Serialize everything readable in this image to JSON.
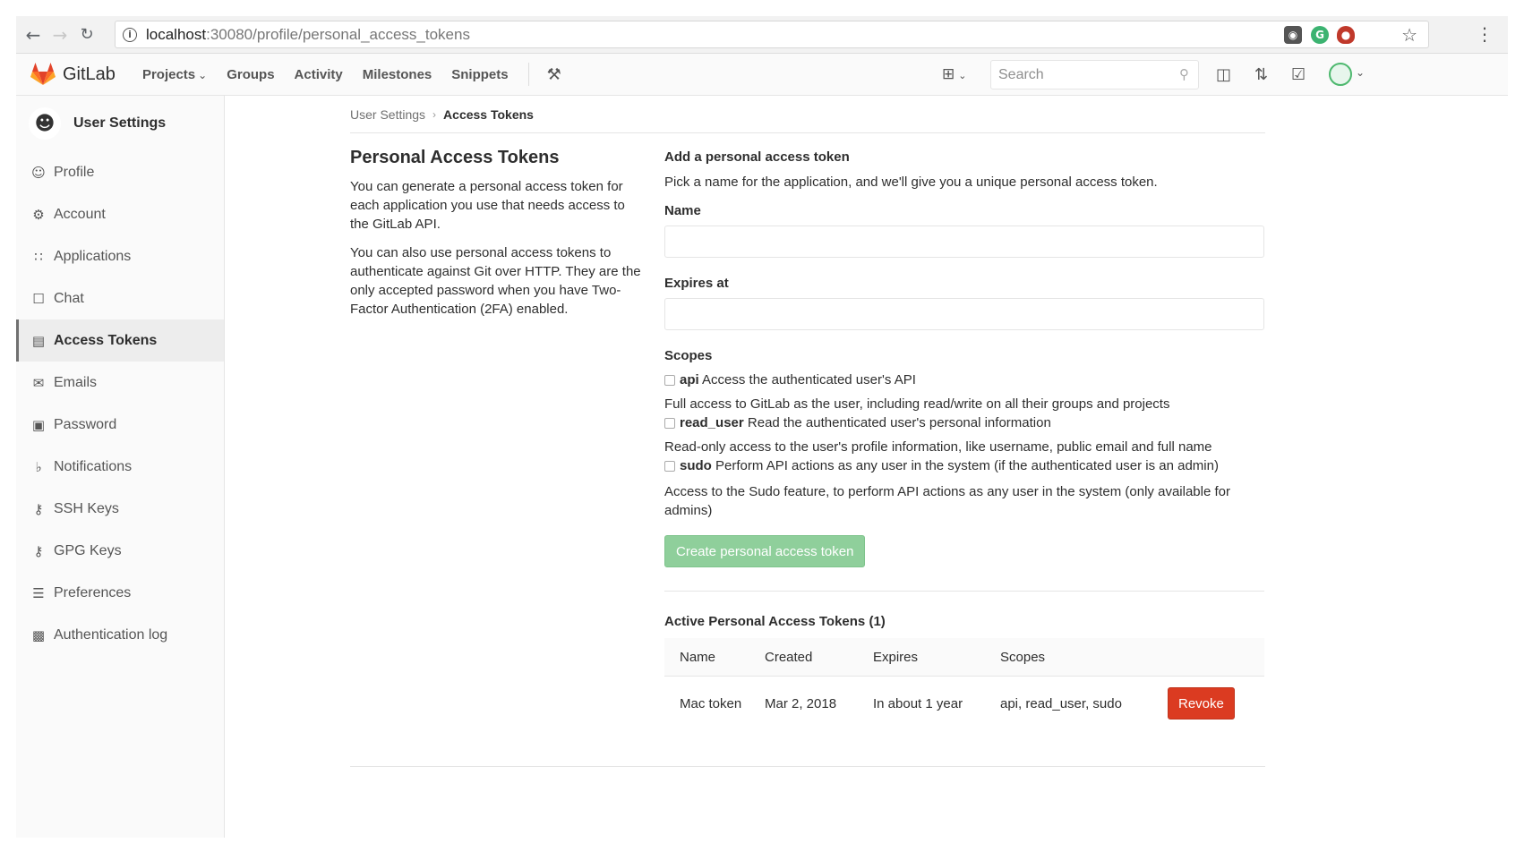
{
  "browser": {
    "url_host": "localhost",
    "url_path": ":30080/profile/personal_access_tokens"
  },
  "header": {
    "brand": "GitLab",
    "nav": [
      "Projects",
      "Groups",
      "Activity",
      "Milestones",
      "Snippets"
    ],
    "search_placeholder": "Search"
  },
  "sidebar": {
    "title": "User Settings",
    "items": [
      {
        "label": "Profile",
        "icon": "profile-icon"
      },
      {
        "label": "Account",
        "icon": "account-icon"
      },
      {
        "label": "Applications",
        "icon": "applications-icon"
      },
      {
        "label": "Chat",
        "icon": "chat-icon"
      },
      {
        "label": "Access Tokens",
        "icon": "token-icon",
        "active": true
      },
      {
        "label": "Emails",
        "icon": "email-icon"
      },
      {
        "label": "Password",
        "icon": "lock-icon"
      },
      {
        "label": "Notifications",
        "icon": "bell-icon"
      },
      {
        "label": "SSH Keys",
        "icon": "key-icon"
      },
      {
        "label": "GPG Keys",
        "icon": "key-icon"
      },
      {
        "label": "Preferences",
        "icon": "sliders-icon"
      },
      {
        "label": "Authentication log",
        "icon": "log-icon"
      }
    ]
  },
  "breadcrumb": {
    "parent": "User Settings",
    "current": "Access Tokens"
  },
  "intro": {
    "title": "Personal Access Tokens",
    "p1": "You can generate a personal access token for each application you use that needs access to the GitLab API.",
    "p2": "You can also use personal access tokens to authenticate against Git over HTTP. They are the only accepted password when you have Two-Factor Authentication (2FA) enabled."
  },
  "form": {
    "heading": "Add a personal access token",
    "description": "Pick a name for the application, and we'll give you a unique personal access token.",
    "name_label": "Name",
    "expires_label": "Expires at",
    "scopes_label": "Scopes",
    "scopes": [
      {
        "key": "api",
        "summary": "Access the authenticated user's API",
        "detail": "Full access to GitLab as the user, including read/write on all their groups and projects"
      },
      {
        "key": "read_user",
        "summary": "Read the authenticated user's personal information",
        "detail": "Read-only access to the user's profile information, like username, public email and full name"
      },
      {
        "key": "sudo",
        "summary": "Perform API actions as any user in the system (if the authenticated user is an admin)",
        "detail": "Access to the Sudo feature, to perform API actions as any user in the system (only available for admins)"
      }
    ],
    "submit_label": "Create personal access token"
  },
  "active_tokens": {
    "heading": "Active Personal Access Tokens (1)",
    "columns": [
      "Name",
      "Created",
      "Expires",
      "Scopes"
    ],
    "rows": [
      {
        "name": "Mac token",
        "created": "Mar 2, 2018",
        "expires": "In about 1 year",
        "scopes": "api, read_user, sudo",
        "action": "Revoke"
      }
    ]
  }
}
